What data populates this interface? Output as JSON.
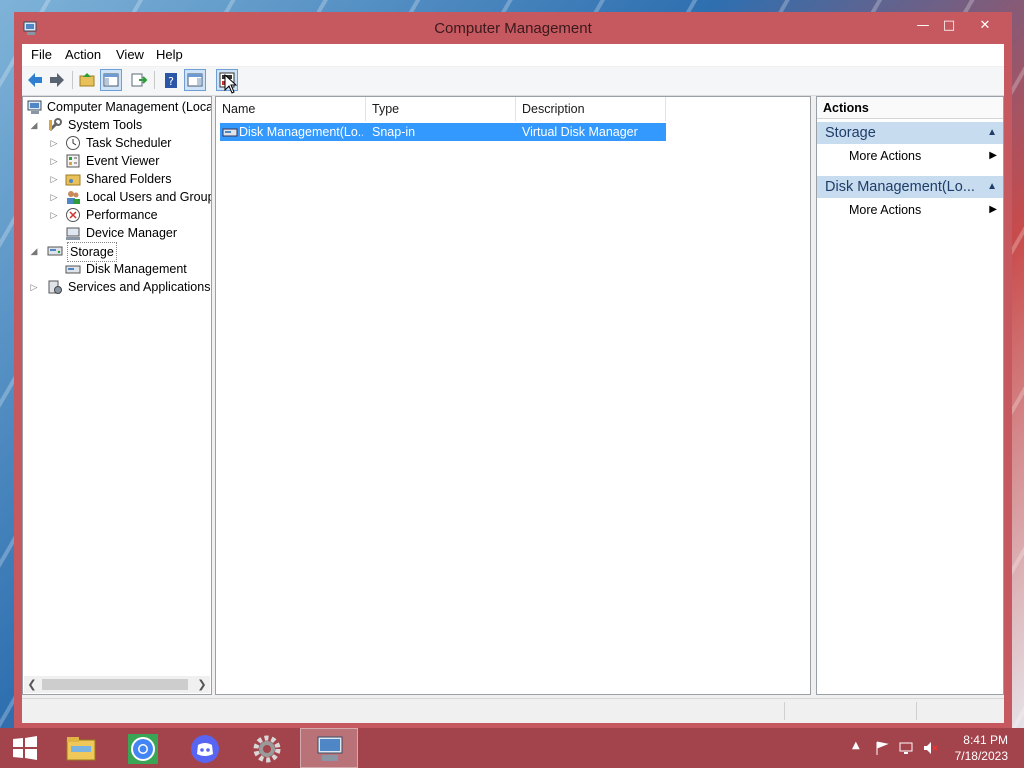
{
  "window": {
    "title": "Computer Management"
  },
  "menu": [
    "File",
    "Action",
    "View",
    "Help"
  ],
  "toolbar": {
    "buttons": [
      "back-arrow",
      "forward-arrow",
      "up-folder",
      "show-hide-console-tree",
      "export-list",
      "help",
      "show-hide-action-pane",
      "properties"
    ]
  },
  "tree": {
    "root": "Computer Management (Local",
    "items": [
      {
        "label": "System Tools",
        "icon": "tools-icon"
      },
      {
        "label": "Task Scheduler",
        "icon": "clock-icon"
      },
      {
        "label": "Event Viewer",
        "icon": "event-viewer-icon"
      },
      {
        "label": "Shared Folders",
        "icon": "shared-folder-icon"
      },
      {
        "label": "Local Users and Groups",
        "icon": "users-icon"
      },
      {
        "label": "Performance",
        "icon": "performance-icon"
      },
      {
        "label": "Device Manager",
        "icon": "device-manager-icon"
      },
      {
        "label": "Storage",
        "icon": "storage-icon"
      },
      {
        "label": "Disk Management",
        "icon": "disk-icon"
      },
      {
        "label": "Services and Applications",
        "icon": "services-icon"
      }
    ]
  },
  "list": {
    "columns": [
      "Name",
      "Type",
      "Description"
    ],
    "rows": [
      {
        "name": "Disk Management(Lo...",
        "type": "Snap-in",
        "description": "Virtual Disk Manager"
      }
    ]
  },
  "actions": {
    "header": "Actions",
    "groups": [
      {
        "title": "Storage",
        "item": "More Actions"
      },
      {
        "title": "Disk Management(Lo...",
        "item": "More Actions"
      }
    ]
  },
  "taskbar": {
    "apps": [
      "start-icon",
      "file-explorer-icon",
      "chrome-icon",
      "discord-icon",
      "settings-gear-icon",
      "computer-management-icon"
    ],
    "time": "8:41 PM",
    "date": "7/18/2023"
  },
  "colors": {
    "window_frame": "#c6585f",
    "selection": "#3399ff",
    "action_group": "#c8dcf0",
    "taskbar": "#a3434c"
  }
}
